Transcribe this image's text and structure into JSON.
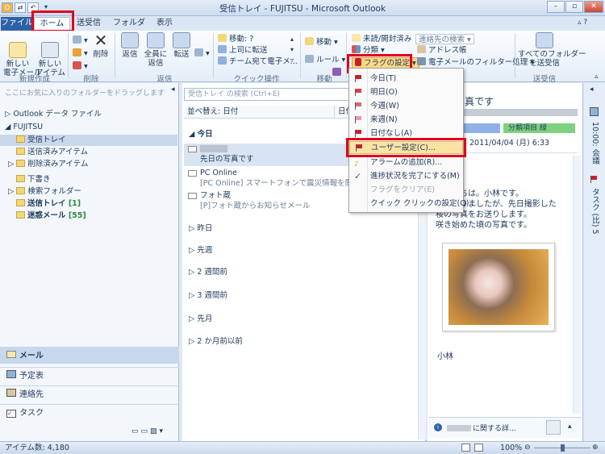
{
  "window": {
    "title": "受信トレイ - FUJITSU - Microsoft Outlook"
  },
  "tabs": [
    "ファイル",
    "ホーム",
    "送受信",
    "フォルダー",
    "表示"
  ],
  "ribbon": {
    "new_mail": "新しい\n電子メール",
    "new_items": "新しい\nアイテム",
    "delete": "削除",
    "reply": "返信",
    "reply_all": "全員に\n返信",
    "forward": "転送",
    "quick_move": "移動: ?",
    "to_manager": "上司に転送",
    "team_email": "チーム宛て電子メ...",
    "move": "移動",
    "rules": "ルール",
    "unread": "未読/開封済み",
    "categorize": "分類",
    "followup": "フラグの設定",
    "find_contact": "連絡先の検索",
    "address_book": "アドレス帳",
    "filter_email": "電子メールのフィルター処理",
    "send_receive_all": "すべてのフォルダー\nを送受信",
    "groups": {
      "new": "新規作成",
      "delete": "削除",
      "respond": "返信",
      "quick_steps": "クイック操作",
      "move": "移動",
      "send_receive": "送受信"
    }
  },
  "nav": {
    "favorites_hint": "ここにお気に入りのフォルダーをドラッグします",
    "data_file": "Outlook データ ファイル",
    "account": "FUJITSU",
    "folders": [
      {
        "label": "受信トレイ",
        "count": ""
      },
      {
        "label": "送信済みアイテム",
        "count": ""
      },
      {
        "label": "削除済みアイテム",
        "count": ""
      },
      {
        "label": "下書き",
        "count": ""
      },
      {
        "label": "検索フォルダー",
        "count": ""
      },
      {
        "label": "送信トレイ",
        "count": "[1]"
      },
      {
        "label": "迷惑メール",
        "count": "[55]"
      }
    ],
    "bottom": [
      "メール",
      "予定表",
      "連絡先",
      "タスク"
    ]
  },
  "list": {
    "search_placeholder": "受信トレイ の検索 (Ctrl+E)",
    "sort_label": "並べ替え: 日付",
    "sort_col": "日付",
    "today": "今日",
    "mails": [
      {
        "from": "",
        "subject": "先日の写真です"
      },
      {
        "from": "PC Online",
        "subject": "[PC Online] スマートフォンで震災情報を閲覧／春の"
      },
      {
        "from": "フォト蔵",
        "subject": "[P]フォト蔵からお知らせメール"
      }
    ],
    "groups": [
      "昨日",
      "先週",
      "2 週間前",
      "3 週間前",
      "先月",
      "2 か月前以前"
    ]
  },
  "reading": {
    "subject": "写真です",
    "category_blue": "青",
    "category_green": "分類項目 緑",
    "date": "2011/04/04 (月) 6:33",
    "body": [
      "ちは。小林です。",
      "りましたが、先日撮影した",
      "桜の写真をお送りします。",
      "咲き始めた頃の写真です。"
    ],
    "signature": "小林",
    "people_pane": "に関する詳..."
  },
  "todo": {
    "date": "10:00: 会議",
    "tasks": "タスク (比) 5"
  },
  "menu": {
    "items": [
      "今日(T)",
      "明日(O)",
      "今週(W)",
      "来週(N)",
      "日付なし(A)",
      "ユーザー設定(C)...",
      "アラームの追加(R)...",
      "進捗状況を完了にする(M)",
      "フラグをクリア(E)",
      "クイック クリックの設定(Q)..."
    ]
  },
  "status": {
    "items": "アイテム数: 4,180",
    "zoom": "100%"
  },
  "colors": {
    "accent": "#2c62a6",
    "highlight": "#e0001b"
  }
}
